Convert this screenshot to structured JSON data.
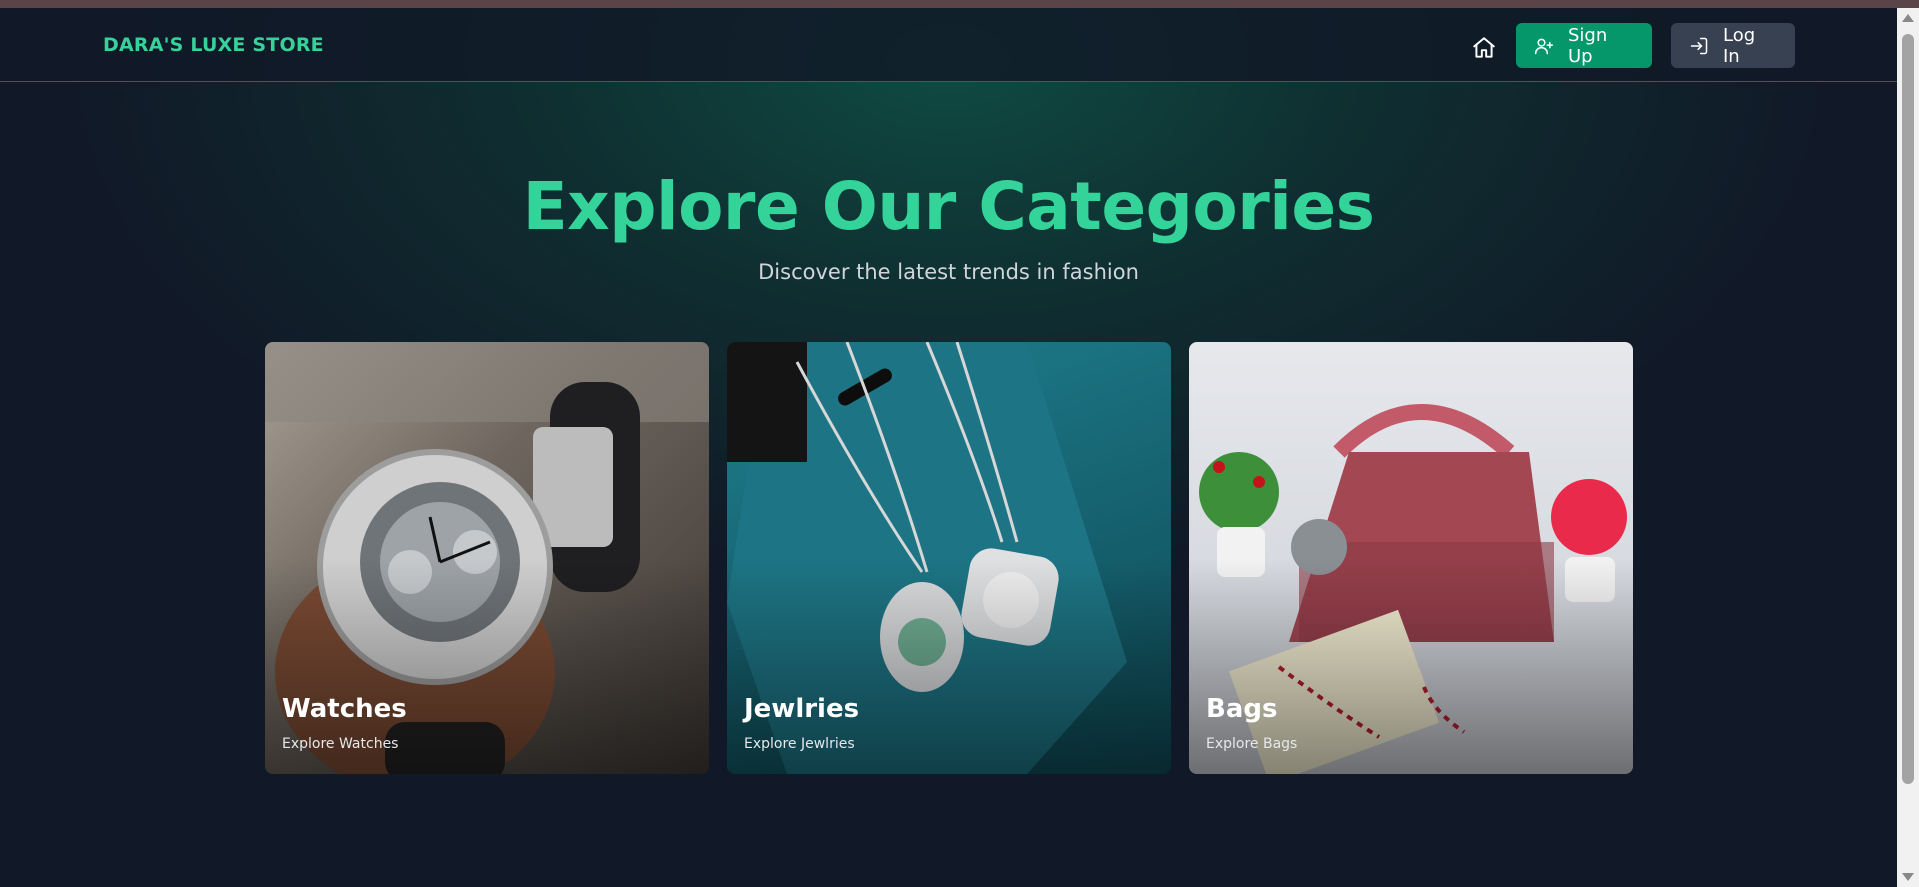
{
  "nav": {
    "brand": "DARA'S LUXE STORE",
    "signup_label": "Sign Up",
    "login_label": "Log In"
  },
  "hero": {
    "title": "Explore Our Categories",
    "subtitle": "Discover the latest trends in fashion"
  },
  "categories": [
    {
      "title": "Watches",
      "link": "Explore Watches"
    },
    {
      "title": "Jewlries",
      "link": "Explore Jewlries"
    },
    {
      "title": "Bags",
      "link": "Explore Bags"
    }
  ],
  "colors": {
    "accent": "#34d399",
    "signup_bg": "#059669",
    "login_bg": "#374151",
    "page_bg": "#111827"
  },
  "icons": [
    "home-icon",
    "user-plus-icon",
    "login-icon"
  ]
}
